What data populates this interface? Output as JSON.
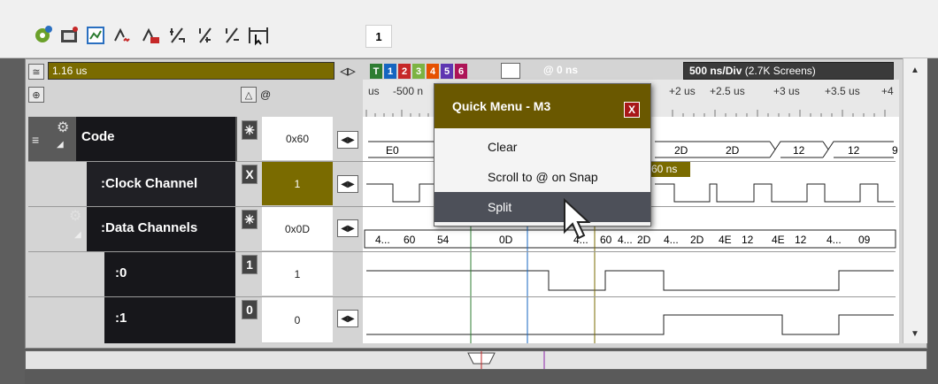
{
  "toolbar": {
    "icons": [
      "settings-gear-icon",
      "trigger-icon",
      "capture-icon",
      "cursor-icon",
      "in-out-icon",
      "half-icon",
      "quarter-icon",
      "slash-icon",
      "fit-icon"
    ],
    "counter": "1"
  },
  "header": {
    "time_value": "1.16 us",
    "at_symbol": "@",
    "channel_tabs": [
      {
        "label": "T",
        "color": "#2e7d32"
      },
      {
        "label": "1",
        "color": "#1565c0"
      },
      {
        "label": "2",
        "color": "#c62828"
      },
      {
        "label": "3",
        "color": "#7cb342"
      },
      {
        "label": "4",
        "color": "#e65100"
      },
      {
        "label": "5",
        "color": "#5e35b1"
      },
      {
        "label": "6",
        "color": "#ad1457"
      }
    ],
    "at_time": "@ 0 ns",
    "div_label": "500 ns/Div",
    "div_screens": "(2.7K Screens)"
  },
  "ruler": {
    "left_labels": [
      "us",
      "-500 n"
    ],
    "right_labels": [
      "+2 us",
      "+2.5 us",
      "+3 us",
      "+3.5 us",
      "+4"
    ]
  },
  "channels": [
    {
      "name": "Code",
      "mode": "✳",
      "value": "0x60"
    },
    {
      "name": ":Clock Channel",
      "mode": "X",
      "value": "1"
    },
    {
      "name": ":Data Channels",
      "mode": "✳",
      "value": "0x0D"
    },
    {
      "name": ":0",
      "mode": "1",
      "value": "1"
    },
    {
      "name": ":1",
      "mode": "0",
      "value": "0"
    }
  ],
  "waveforms": {
    "code_segments": [
      "E0",
      "2D",
      "2D",
      "12",
      "12",
      "9"
    ],
    "clock_marker": "60 ns",
    "data_segments": [
      "4...",
      "60",
      "54",
      "0D",
      "4...",
      "60",
      "4...",
      "2D",
      "4...",
      "2D",
      "4E",
      "12",
      "4E",
      "12",
      "4...",
      "09"
    ]
  },
  "quick_menu": {
    "title": "Quick Menu - M3",
    "close": "X",
    "items": [
      {
        "label": "Clear",
        "selected": false
      },
      {
        "label": "Scroll to @ on Snap",
        "selected": false
      },
      {
        "label": "Split",
        "selected": true
      }
    ]
  }
}
